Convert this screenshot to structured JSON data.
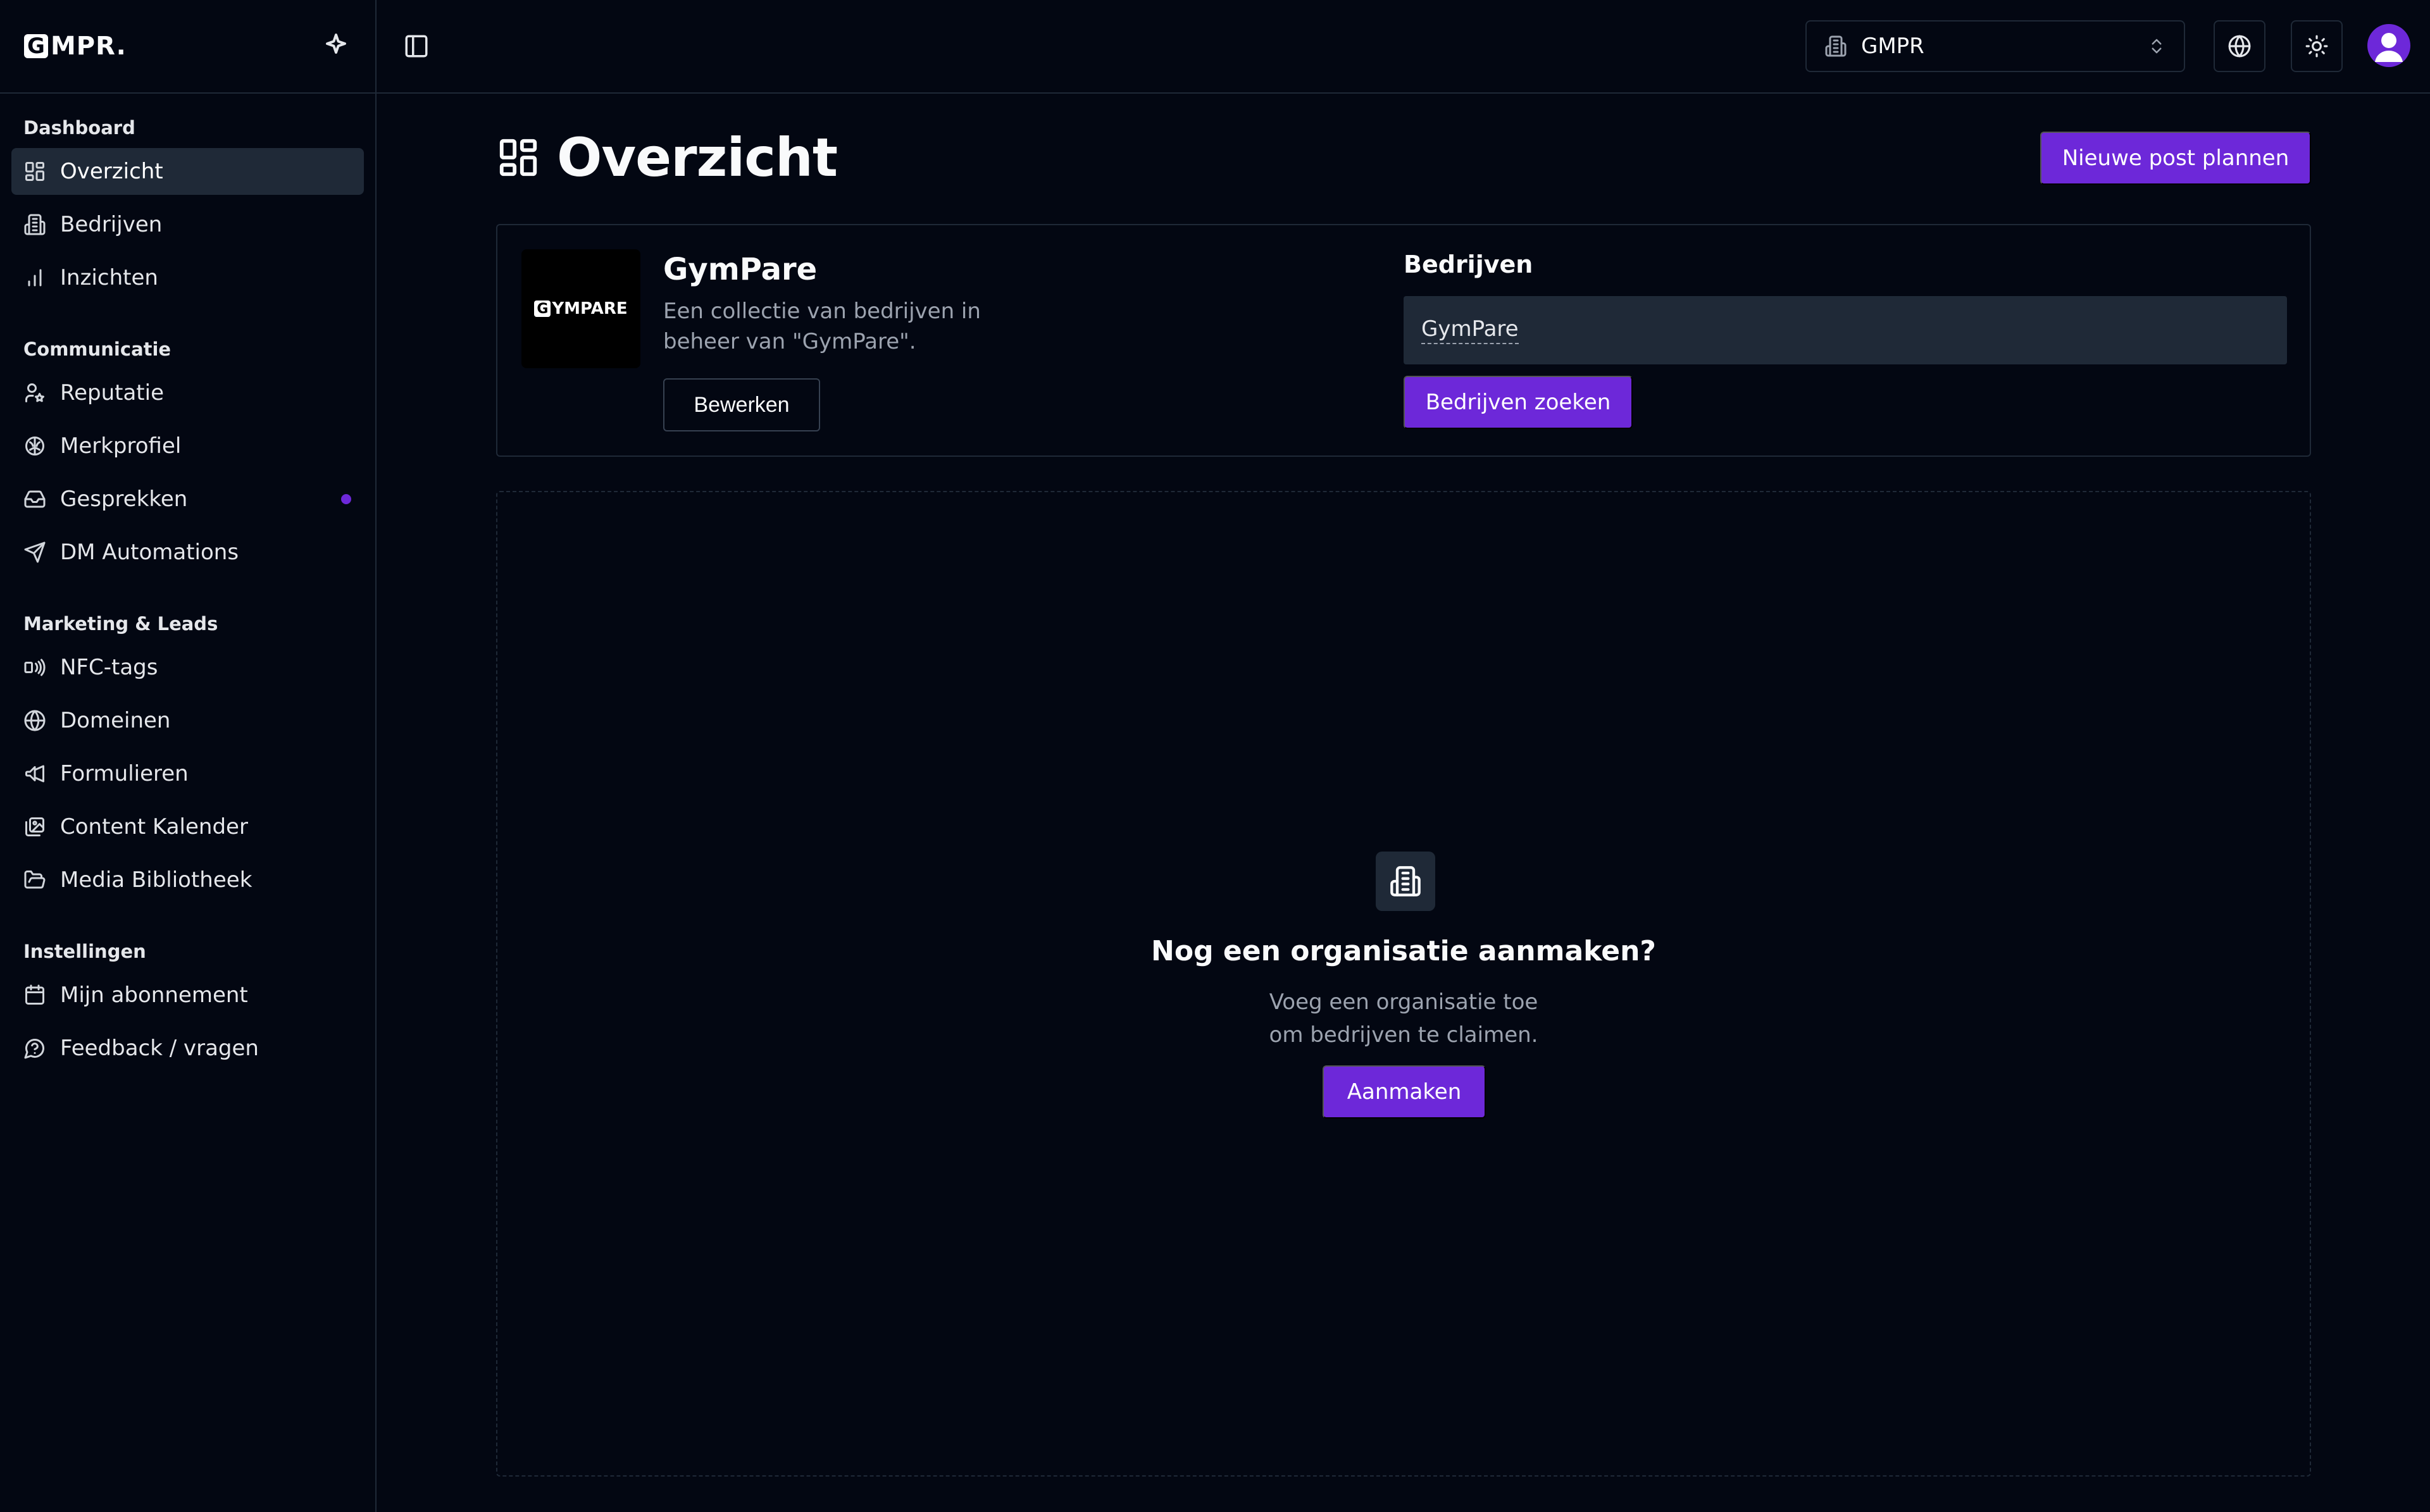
{
  "app": {
    "logo_initial": "G",
    "logo_text": "MPR."
  },
  "sidebar": {
    "groups": [
      {
        "title": "Dashboard",
        "items": [
          {
            "label": "Overzicht",
            "icon": "layout-grid-icon",
            "active": true
          },
          {
            "label": "Bedrijven",
            "icon": "building-icon"
          },
          {
            "label": "Inzichten",
            "icon": "bar-chart-icon"
          }
        ]
      },
      {
        "title": "Communicatie",
        "items": [
          {
            "label": "Reputatie",
            "icon": "user-star-icon"
          },
          {
            "label": "Merkprofiel",
            "icon": "brain-icon"
          },
          {
            "label": "Gesprekken",
            "icon": "inbox-icon",
            "badge_dot": true
          },
          {
            "label": "DM Automations",
            "icon": "send-icon"
          }
        ]
      },
      {
        "title": "Marketing & Leads",
        "items": [
          {
            "label": "NFC-tags",
            "icon": "nfc-icon"
          },
          {
            "label": "Domeinen",
            "icon": "globe-icon"
          },
          {
            "label": "Formulieren",
            "icon": "megaphone-icon"
          },
          {
            "label": "Content Kalender",
            "icon": "images-icon"
          },
          {
            "label": "Media Bibliotheek",
            "icon": "folder-open-icon"
          }
        ]
      },
      {
        "title": "Instellingen",
        "items": [
          {
            "label": "Mijn abonnement",
            "icon": "calendar-icon"
          },
          {
            "label": "Feedback / vragen",
            "icon": "help-circle-icon"
          }
        ]
      }
    ]
  },
  "topbar": {
    "org_select_value": "GMPR"
  },
  "main": {
    "title": "Overzicht",
    "new_post_label": "Nieuwe post plannen",
    "org_card": {
      "logo_initial": "G",
      "logo_text": "YMPARE",
      "name": "GymPare",
      "description": "Een collectie van bedrijven in beheer van \"GymPare\".",
      "edit_label": "Bewerken",
      "companies_label": "Bedrijven",
      "companies_value": "GymPare",
      "search_label": "Bedrijven zoeken"
    },
    "empty_state": {
      "title": "Nog een organisatie aanmaken?",
      "desc_line1": "Voeg een organisatie toe",
      "desc_line2": "om bedrijven te claimen.",
      "button_label": "Aanmaken"
    }
  },
  "colors": {
    "background": "#030712",
    "border": "#1f2937",
    "accent": "#6d28d9",
    "muted_text": "#9ca3af"
  }
}
